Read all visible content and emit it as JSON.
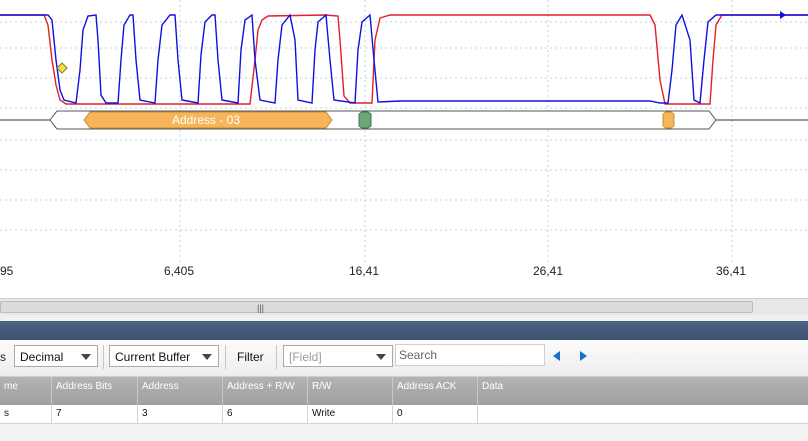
{
  "waveform": {
    "x_ticks": [
      "95",
      "6,405",
      "16,41",
      "26,41",
      "36,41"
    ],
    "decoded_label": "Address - 03",
    "colors": {
      "blue_trace": "#1010e0",
      "red_trace": "#e0202a",
      "grid": "#b8d0e4",
      "address_fill": "#f5b558",
      "ack_fill": "#6fa878",
      "marker_fill": "#f2e05c"
    }
  },
  "toolbar": {
    "left_cut_label": "s",
    "format_select": "Decimal",
    "buffer_select": "Current Buffer",
    "filter_label": "Filter",
    "field_select": "[Field]",
    "search_placeholder": "Search",
    "prev_icon": "triangle-left-icon",
    "next_icon": "triangle-right-icon"
  },
  "table": {
    "columns": [
      "me",
      "Address Bits",
      "Address",
      "Address + R/W",
      "R/W",
      "Address ACK",
      "Data"
    ],
    "rows": [
      [
        "s",
        "7",
        "3",
        "6",
        "Write",
        "0",
        ""
      ]
    ]
  }
}
